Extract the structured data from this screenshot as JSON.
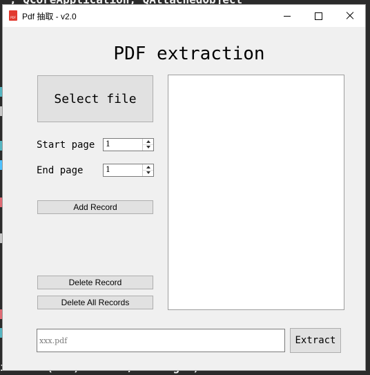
{
  "background_editor": {
    "top_line": "; QCoreApplication, QAttachedObject",
    "bottom_line": "ifd.out(str).fileld,outhraget)"
  },
  "window": {
    "title": "Pdf 抽取 - v2.0",
    "icon": "pdf-file-icon",
    "controls": {
      "minimize": "minimize-icon",
      "maximize": "maximize-icon",
      "close": "close-icon"
    }
  },
  "main": {
    "heading": "PDF extraction",
    "select_file_label": "Select file",
    "start_page": {
      "label": "Start page",
      "value": "1"
    },
    "end_page": {
      "label": "End page",
      "value": "1"
    },
    "add_record_label": "Add Record",
    "delete_record_label": "Delete Record",
    "delete_all_label": "Delete All Records",
    "records": [],
    "output": {
      "placeholder": "xxx.pdf",
      "value": ""
    },
    "extract_label": "Extract"
  }
}
